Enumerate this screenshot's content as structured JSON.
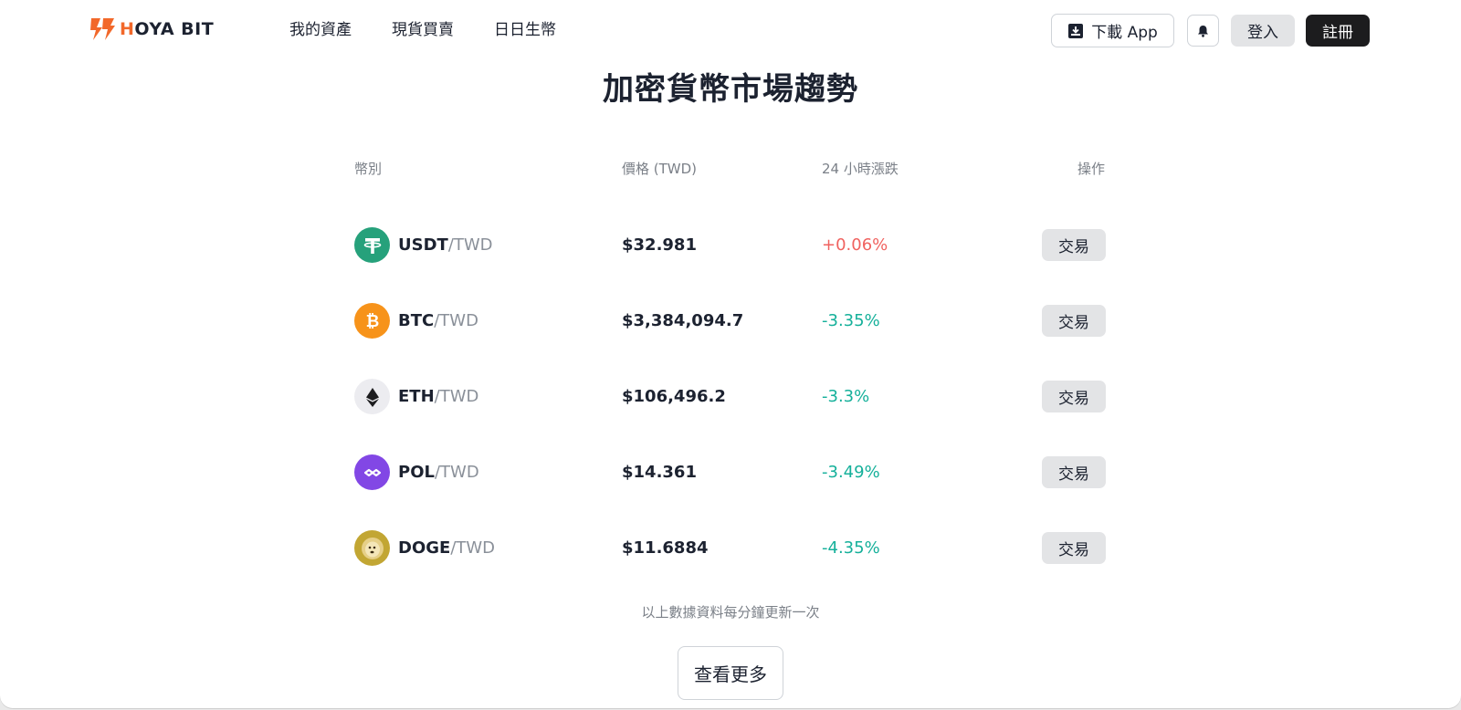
{
  "header": {
    "brand": "HOYA BIT",
    "nav": [
      "我的資產",
      "現貨買賣",
      "日日生幣"
    ],
    "download_label": "下載 App",
    "login_label": "登入",
    "register_label": "註冊"
  },
  "main": {
    "title": "加密貨幣市場趨勢",
    "columns": {
      "coin": "幣別",
      "price": "價格 (TWD)",
      "change": "24 小時漲跌",
      "action": "操作"
    },
    "rows": [
      {
        "symbol": "USDT",
        "quote": "/TWD",
        "price": "$32.981",
        "change": "+0.06%",
        "direction": "up",
        "icon": "usdt-icon",
        "color": "#26a17b",
        "action": "交易"
      },
      {
        "symbol": "BTC",
        "quote": "/TWD",
        "price": "$3,384,094.7",
        "change": "-3.35%",
        "direction": "down",
        "icon": "btc-icon",
        "color": "#f7931a",
        "action": "交易"
      },
      {
        "symbol": "ETH",
        "quote": "/TWD",
        "price": "$106,496.2",
        "change": "-3.3%",
        "direction": "down",
        "icon": "eth-icon",
        "color": "#ececf0",
        "action": "交易"
      },
      {
        "symbol": "POL",
        "quote": "/TWD",
        "price": "$14.361",
        "change": "-3.49%",
        "direction": "down",
        "icon": "pol-icon",
        "color": "#8247e5",
        "action": "交易"
      },
      {
        "symbol": "DOGE",
        "quote": "/TWD",
        "price": "$11.6884",
        "change": "-4.35%",
        "direction": "down",
        "icon": "doge-icon",
        "color": "#c2a633",
        "action": "交易"
      }
    ],
    "note": "以上數據資料每分鐘更新一次",
    "more_label": "查看更多"
  },
  "colors": {
    "brand": "#f2682a",
    "up": "#f0625f",
    "down": "#15b09a",
    "dark": "#1c1c1e"
  }
}
